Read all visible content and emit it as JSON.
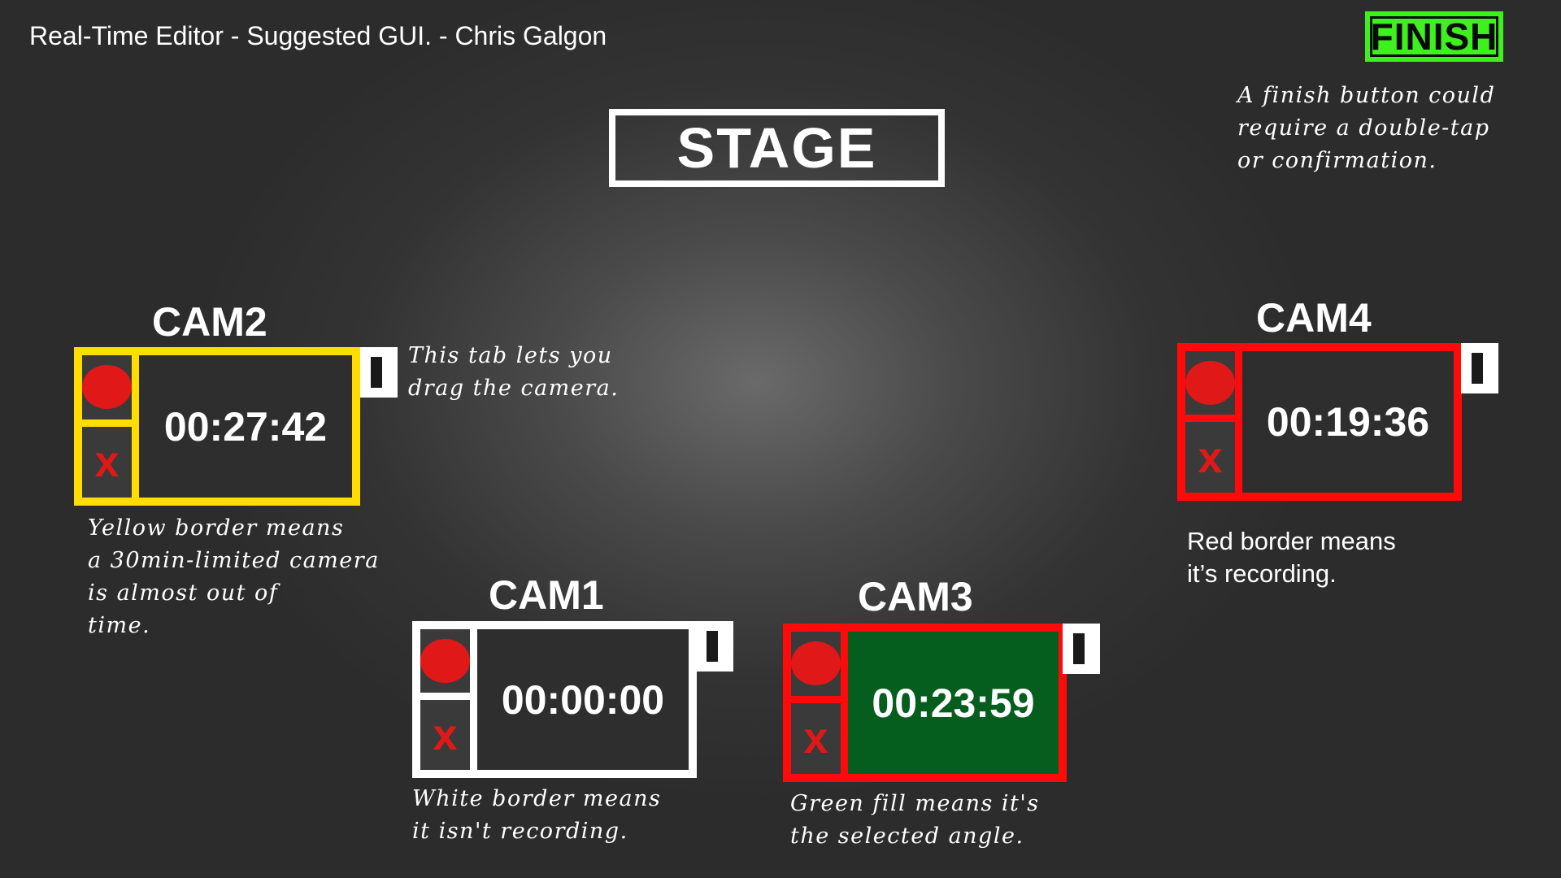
{
  "header": {
    "title": "Real-Time Editor - Suggested GUI. - Chris Galgon",
    "finish_label": "FINISH"
  },
  "stage": {
    "label": "STAGE"
  },
  "notes": {
    "finish": [
      "A finish button could",
      "require a double-tap",
      "or confirmation."
    ],
    "drag_tab": [
      "This tab lets you",
      "drag the camera."
    ],
    "yellow": [
      "Yellow border means",
      "a 30min-limited camera",
      "is almost out of",
      "time."
    ],
    "white": [
      "White border means",
      "it isn't recording."
    ],
    "green": [
      "Green fill means it's",
      "the selected angle."
    ],
    "red": [
      "Red border means",
      "it’s recording."
    ]
  },
  "cameras": [
    {
      "name": "CAM2",
      "time": "00:27:42",
      "border": "yellow",
      "border_color": "#ffdd00",
      "recording": false,
      "selected": false,
      "near_limit": true,
      "delete_label": "x"
    },
    {
      "name": "CAM1",
      "time": "00:00:00",
      "border": "white",
      "border_color": "#ffffff",
      "recording": false,
      "selected": false,
      "near_limit": false,
      "delete_label": "x"
    },
    {
      "name": "CAM3",
      "time": "00:23:59",
      "border": "red",
      "border_color": "#ff0a0a",
      "recording": true,
      "selected": true,
      "fill_color": "#055d1e",
      "delete_label": "x"
    },
    {
      "name": "CAM4",
      "time": "00:19:36",
      "border": "red",
      "border_color": "#ff0a0a",
      "recording": true,
      "selected": false,
      "delete_label": "x"
    }
  ],
  "colors": {
    "finish_bg": "#3ef01e",
    "record_dot": "#e01818",
    "delete_x": "#e01818",
    "background": "#333333"
  },
  "icons": {
    "record": "record-dot-icon",
    "delete": "delete-x-icon",
    "drag": "drag-handle-icon"
  }
}
